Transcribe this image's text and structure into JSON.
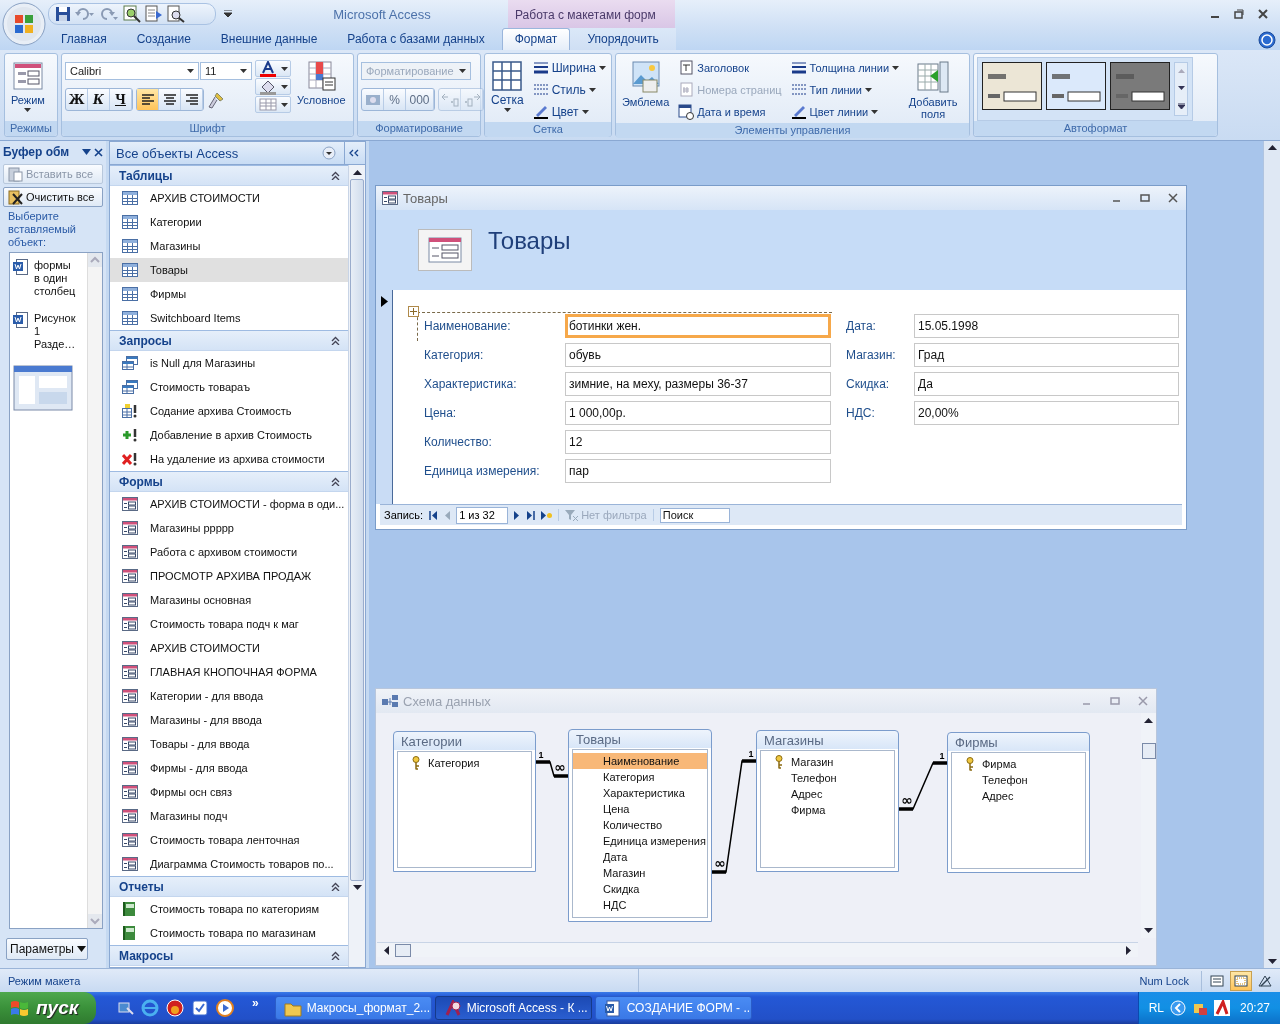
{
  "app": {
    "title": "Microsoft Access",
    "context_label": "Работа с макетами форм"
  },
  "ribbon_tabs": [
    {
      "label": "Главная",
      "selected": false,
      "kind": "main"
    },
    {
      "label": "Создание",
      "selected": false,
      "kind": "main"
    },
    {
      "label": "Внешние данные",
      "selected": false,
      "kind": "main"
    },
    {
      "label": "Работа с базами данных",
      "selected": false,
      "kind": "main"
    },
    {
      "label": "Формат",
      "selected": true,
      "kind": "context"
    },
    {
      "label": "Упорядочить",
      "selected": false,
      "kind": "context"
    }
  ],
  "ribbon": {
    "views": {
      "label": "Режимы",
      "button": "Режим"
    },
    "font": {
      "label": "Шрифт",
      "font_name": "Calibri",
      "font_size": "11",
      "styles": [
        {
          "label": "Ж",
          "selected": false
        },
        {
          "label": "К",
          "selected": false
        },
        {
          "label": "Ч",
          "selected": false
        }
      ],
      "alignment": [
        {
          "kind": "left",
          "selected": true
        },
        {
          "kind": "center",
          "selected": false
        },
        {
          "kind": "right",
          "selected": false
        }
      ],
      "conditional": "Условное"
    },
    "formatting": {
      "label": "Форматирование",
      "format_box": "Форматирование",
      "disabled": true,
      "symbols": [
        "%",
        "000"
      ]
    },
    "gridlines": {
      "label": "Сетка",
      "button": "Сетка",
      "menus": [
        {
          "kind": "width",
          "label": "Ширина"
        },
        {
          "kind": "style",
          "label": "Стиль"
        },
        {
          "kind": "color",
          "label": "Цвет"
        }
      ]
    },
    "controls": {
      "label": "Элементы управления",
      "logo": "Эмблема",
      "inserts": [
        {
          "kind": "title",
          "label": "Заголовок",
          "disabled": false
        },
        {
          "kind": "page_numbers",
          "label": "Номера страниц",
          "disabled": true
        },
        {
          "kind": "date_time",
          "label": "Дата и время",
          "disabled": false
        }
      ],
      "lines": [
        {
          "kind": "thickness",
          "label": "Толщина линии"
        },
        {
          "kind": "type",
          "label": "Тип линии"
        },
        {
          "kind": "color",
          "label": "Цвет линии"
        }
      ],
      "add_fields": "Добавить поля"
    },
    "autoformat": {
      "label": "Автоформат",
      "styles": [
        {
          "kind": "beige"
        },
        {
          "kind": "blue"
        },
        {
          "kind": "gray"
        }
      ]
    }
  },
  "clipboard": {
    "title": "Буфер обм",
    "paste_all": {
      "label": "Вставить все",
      "disabled": true
    },
    "clear_all": {
      "label": "Очистить все",
      "disabled": false
    },
    "hint": "Выберите вставляемый объект:",
    "items": [
      {
        "kind": "document",
        "text": "формы в один столбец"
      },
      {
        "kind": "document",
        "text": "Рисунок 1 Разде…"
      },
      {
        "kind": "image"
      }
    ],
    "options": "Параметры"
  },
  "navigation": {
    "title": "Все объекты Access",
    "groups": [
      {
        "title": "Таблицы",
        "expanded": true,
        "items": [
          {
            "label": "АРХИВ СТОИМОСТИ",
            "kind": "table",
            "selected": false
          },
          {
            "label": "Категории",
            "kind": "table",
            "selected": false
          },
          {
            "label": "Магазины",
            "kind": "table",
            "selected": false
          },
          {
            "label": "Товары",
            "kind": "table",
            "selected": true
          },
          {
            "label": "Фирмы",
            "kind": "table",
            "selected": false
          },
          {
            "label": "Switchboard Items",
            "kind": "table",
            "selected": false
          }
        ]
      },
      {
        "title": "Запросы",
        "expanded": true,
        "items": [
          {
            "label": "is Null для Магазины",
            "kind": "select_query",
            "selected": false
          },
          {
            "label": "Стоимость товараъ",
            "kind": "select_query",
            "selected": false
          },
          {
            "label": "Содание архива Стоимость",
            "kind": "make_query",
            "selected": false
          },
          {
            "label": "Добавление в архив Стоимость",
            "kind": "append_query",
            "selected": false
          },
          {
            "label": "На удаление из архива стоимости",
            "kind": "delete_query",
            "selected": false
          }
        ]
      },
      {
        "title": "Формы",
        "expanded": true,
        "items": [
          {
            "label": "АРХИВ СТОИМОСТИ - форма в оди...",
            "kind": "form",
            "selected": false
          },
          {
            "label": "Магазины ррррр",
            "kind": "form",
            "selected": false
          },
          {
            "label": "Работа с архивом стоимости",
            "kind": "form",
            "selected": false
          },
          {
            "label": "ПРОСМОТР АРХИВА ПРОДАЖ",
            "kind": "form",
            "selected": false
          },
          {
            "label": "Магазины основная",
            "kind": "form",
            "selected": false
          },
          {
            "label": "Стоимость товара подч к маг",
            "kind": "form",
            "selected": false
          },
          {
            "label": "АРХИВ СТОИМОСТИ",
            "kind": "form",
            "selected": false
          },
          {
            "label": "ГЛАВНАЯ КНОПОЧНАЯ ФОРМА",
            "kind": "form",
            "selected": false
          },
          {
            "label": "Категории - для ввода",
            "kind": "form",
            "selected": false
          },
          {
            "label": "Магазины - для ввода",
            "kind": "form",
            "selected": false
          },
          {
            "label": "Товары - для ввода",
            "kind": "form",
            "selected": false
          },
          {
            "label": "Фирмы - для ввода",
            "kind": "form",
            "selected": false
          },
          {
            "label": "Фирмы осн связ",
            "kind": "form",
            "selected": false
          },
          {
            "label": "Магазины подч",
            "kind": "form",
            "selected": false
          },
          {
            "label": "Стоимость товара ленточная",
            "kind": "form",
            "selected": false
          },
          {
            "label": "Диаграмма Стоимость товаров по...",
            "kind": "form",
            "selected": false
          }
        ]
      },
      {
        "title": "Отчеты",
        "expanded": true,
        "items": [
          {
            "label": "Стоимость товара по категориям",
            "kind": "report",
            "selected": false
          },
          {
            "label": "Стоимость товара по магазинам",
            "kind": "report",
            "selected": false
          }
        ]
      },
      {
        "title": "Макросы",
        "expanded": true
      }
    ]
  },
  "form_window": {
    "title": "Товары",
    "header": "Товары",
    "fields_left": [
      {
        "label": "Наименование:",
        "value": "ботинки жен.",
        "focused": true
      },
      {
        "label": "Категория:",
        "value": "обувь",
        "focused": false
      },
      {
        "label": "Характеристика:",
        "value": "зимние, на меху, размеры 36-37",
        "focused": false
      },
      {
        "label": "Цена:",
        "value": "1 000,00р.",
        "focused": false
      },
      {
        "label": "Количество:",
        "value": "12",
        "focused": false
      },
      {
        "label": "Единица измерения:",
        "value": "пар",
        "focused": false
      }
    ],
    "fields_right": [
      {
        "label": "Дата:",
        "value": "15.05.1998",
        "focused": false
      },
      {
        "label": "Магазин:",
        "value": "Град",
        "focused": false
      },
      {
        "label": "Скидка:",
        "value": "Да",
        "focused": false
      },
      {
        "label": "НДС:",
        "value": "20,00%",
        "focused": false
      }
    ],
    "record_nav": {
      "label": "Запись:",
      "position": "1 из 32",
      "filter": {
        "label": "Нет фильтра",
        "disabled": true
      },
      "search": {
        "placeholder": "Поиск"
      }
    }
  },
  "relationships_window": {
    "title": "Схема данных",
    "tables": [
      {
        "title": "Категории",
        "fields": [
          {
            "name": "Категория",
            "key": true,
            "selected": false
          }
        ]
      },
      {
        "title": "Товары",
        "fields": [
          {
            "name": "Наименование",
            "key": false,
            "selected": true
          },
          {
            "name": "Категория",
            "key": false,
            "selected": false
          },
          {
            "name": "Характеристика",
            "key": false,
            "selected": false
          },
          {
            "name": "Цена",
            "key": false,
            "selected": false
          },
          {
            "name": "Количество",
            "key": false,
            "selected": false
          },
          {
            "name": "Единица измерения",
            "key": false,
            "selected": false
          },
          {
            "name": "Дата",
            "key": false,
            "selected": false
          },
          {
            "name": "Магазин",
            "key": false,
            "selected": false
          },
          {
            "name": "Скидка",
            "key": false,
            "selected": false
          },
          {
            "name": "НДС",
            "key": false,
            "selected": false
          }
        ]
      },
      {
        "title": "Магазины",
        "fields": [
          {
            "name": "Магазин",
            "key": true,
            "selected": false
          },
          {
            "name": "Телефон",
            "key": false,
            "selected": false
          },
          {
            "name": "Адрес",
            "key": false,
            "selected": false
          },
          {
            "name": "Фирма",
            "key": false,
            "selected": false
          }
        ]
      },
      {
        "title": "Фирмы",
        "fields": [
          {
            "name": "Фирма",
            "key": true,
            "selected": false
          },
          {
            "name": "Телефон",
            "key": false,
            "selected": false
          },
          {
            "name": "Адрес",
            "key": false,
            "selected": false
          }
        ]
      }
    ],
    "relations": [
      {
        "one_label": "1",
        "many_label": "∞"
      },
      {
        "one_label": "1",
        "many_label": "∞"
      },
      {
        "one_label": "1",
        "many_label": "∞"
      }
    ]
  },
  "status_bar": {
    "text": "Режим макета",
    "indicator": "Num Lock",
    "views": [
      {
        "kind": "form",
        "selected": false
      },
      {
        "kind": "layout",
        "selected": true
      },
      {
        "kind": "design",
        "selected": false
      }
    ]
  },
  "taskbar": {
    "start": "пуск",
    "more": "»",
    "tasks": [
      {
        "kind": "folder",
        "label": "Макросы_формат_2...",
        "selected": false
      },
      {
        "kind": "access",
        "label": "Microsoft Access - К ...",
        "selected": true
      },
      {
        "kind": "word",
        "label": "СОЗДАНИЕ ФОРМ - ...",
        "selected": false
      }
    ],
    "language": "RL",
    "clock": "20:27"
  }
}
